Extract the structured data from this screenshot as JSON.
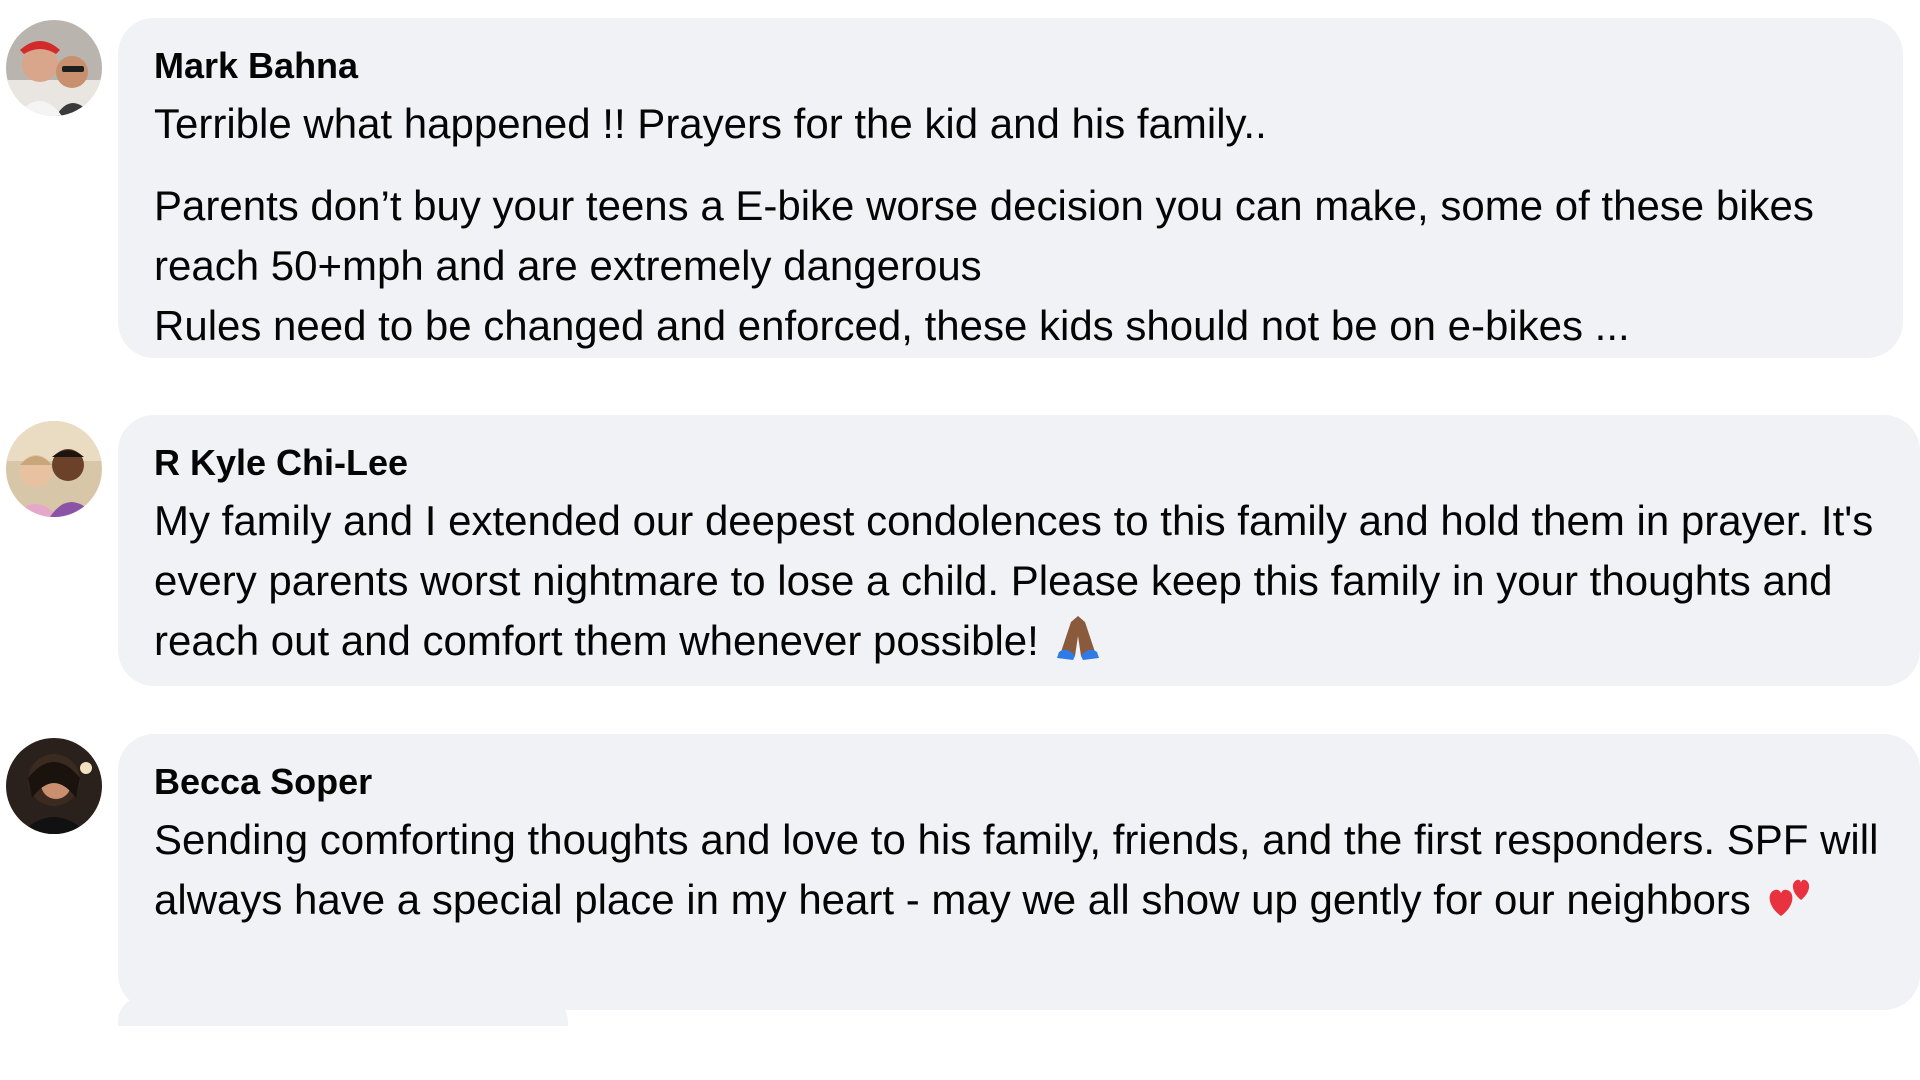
{
  "comments": [
    {
      "author": "Mark Bahna",
      "avatar_icon": "profile-photo-avatar",
      "paragraphs": [
        "Terrible what happened !! Prayers for the kid and his family..",
        "Parents don’t buy your teens a E-bike worse decision you can make, some of these bikes reach 50+mph and are extremely dangerous",
        "Rules need to be changed and enforced, these kids should not be on e-bikes ..."
      ]
    },
    {
      "author": "R Kyle Chi-Lee",
      "avatar_icon": "profile-photo-avatar",
      "paragraphs": [
        "My family and I extended our deepest condolences to this family and hold them in prayer. It's every parents worst nightmare to lose a child. Please keep this family in your thoughts and reach out and comfort them whenever possible!"
      ],
      "emoji_icon": "folded-hands-icon"
    },
    {
      "author": "Becca Soper",
      "avatar_icon": "profile-photo-avatar",
      "paragraphs": [
        "Sending comforting thoughts and love to his family, friends, and the first responders. SPF will always have a special place in my heart - may we all show up gently for our neighbors"
      ],
      "emoji_icon": "two-hearts-icon"
    }
  ],
  "colors": {
    "bubble_bg": "#f0f2f5",
    "text": "#050505",
    "heart": "#e8323f",
    "hands": "#8a5a3c"
  }
}
